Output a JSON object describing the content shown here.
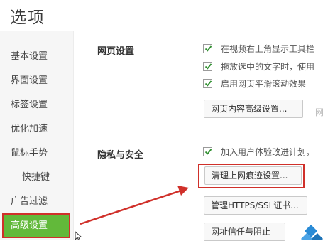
{
  "window": {
    "title": "选项"
  },
  "sidebar": {
    "items": [
      {
        "label": "基本设置",
        "active": false
      },
      {
        "label": "界面设置",
        "active": false
      },
      {
        "label": "标签设置",
        "active": false
      },
      {
        "label": "优化加速",
        "active": false
      },
      {
        "label": "鼠标手势",
        "active": false
      },
      {
        "label": "快捷键",
        "active": false
      },
      {
        "label": "广告过滤",
        "active": false
      },
      {
        "label": "高级设置",
        "active": true
      }
    ]
  },
  "sections": {
    "web": {
      "label": "网页设置",
      "options": [
        {
          "label": "在视频右上角显示工具栏",
          "checked": true
        },
        {
          "label": "拖放选中的文字时，使用",
          "checked": true
        },
        {
          "label": "启用网页平滑滚动效果",
          "checked": true
        }
      ],
      "advanced_button": "网页内容高级设置...",
      "partial_button": "网"
    },
    "privacy": {
      "label": "隐私与安全",
      "options": [
        {
          "label": "加入用户体验改进计划，",
          "checked": true
        }
      ],
      "clear_button": "清理上网痕迹设置...",
      "https_button": "管理HTTPS/SSL证书...",
      "trust_button": "网址信任与阻止"
    }
  },
  "colors": {
    "accent_green": "#62b93a",
    "annotation_red": "#d0302a",
    "check_green": "#2f8f2f"
  },
  "icons": {
    "checkmark": "checkmark-icon",
    "arrow": "annotation-arrow",
    "logo": "corner-logo-icon",
    "cursor": "mouse-cursor-icon"
  }
}
